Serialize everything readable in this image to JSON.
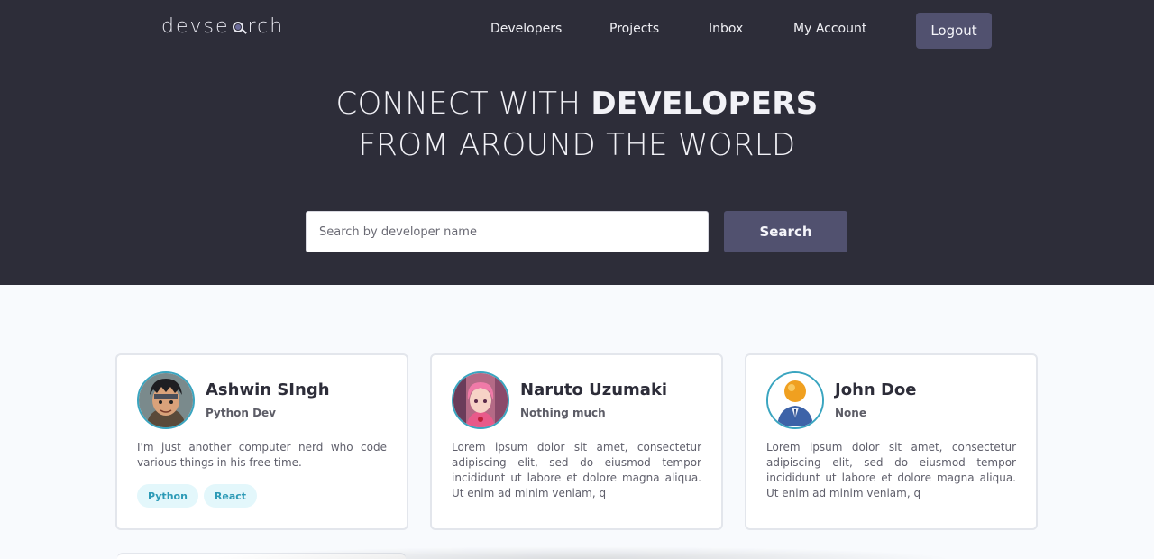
{
  "header": {
    "logo": {
      "prefix": "devse",
      "suffix": "rch",
      "icon": "magnifier-icon"
    },
    "nav": [
      {
        "label": "Developers"
      },
      {
        "label": "Projects"
      },
      {
        "label": "Inbox"
      },
      {
        "label": "My Account"
      }
    ],
    "logout_label": "Logout"
  },
  "hero": {
    "line1_light": "CONNECT WITH ",
    "line1_bold": "DEVELOPERS",
    "line2": "FROM AROUND THE WORLD"
  },
  "search": {
    "placeholder": "Search by developer name",
    "value": "",
    "button_label": "Search"
  },
  "developers": [
    {
      "name": "Ashwin SIngh",
      "role": "Python Dev",
      "bio": "I'm just another computer nerd who code various things in his free time.",
      "tags": [
        "Python",
        "React"
      ],
      "avatar_icon": "anime-boy-avatar-icon"
    },
    {
      "name": "Naruto Uzumaki",
      "role": "Nothing much",
      "bio": "Lorem ipsum dolor sit amet, consectetur adipiscing elit, sed do eiusmod tempor incididunt ut labore et dolore magna aliqua. Ut enim ad minim veniam, q",
      "tags": [],
      "avatar_icon": "anime-girl-avatar-icon"
    },
    {
      "name": "John Doe",
      "role": "None",
      "bio": "Lorem ipsum dolor sit amet, consectetur adipiscing elit, sed do eiusmod tempor incididunt ut labore et dolore magna aliqua. Ut enim ad minim veniam, q",
      "tags": [],
      "avatar_icon": "default-user-avatar-icon"
    }
  ],
  "colors": {
    "header_bg": "#2d2d39",
    "button_bg": "#51516f",
    "page_bg": "#f8fafd",
    "accent": "#3aa5c0",
    "tag_bg": "#e3f7fb"
  }
}
